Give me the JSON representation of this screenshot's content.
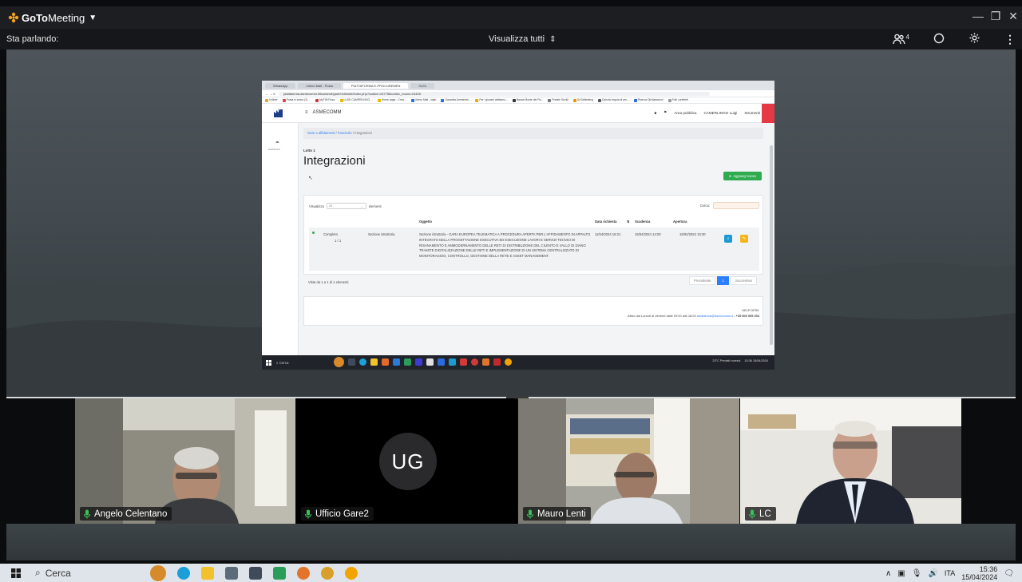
{
  "app": {
    "brand_bold": "GoTo",
    "brand_rest": "Meeting",
    "speaking_label": "Sta parlando:",
    "view_all_label": "Visualizza tutti",
    "participants_count": "4"
  },
  "shared_screen": {
    "tabs": [
      "WhatsApp",
      "Libero Mail - Posta",
      "PIATTAFORMA E-PROCUREMEN",
      "GoTo"
    ],
    "url": "piattaforma.asmecomm.it/backend/gare/richieste/index.php?codice=247758codice_round=24405",
    "bookmarks": [
      "Volture",
      "Posta in arrivo (2) ...",
      "MyTIM Fisso",
      "LUIGI CAMERLINGO ...",
      "Home page - Crea...",
      "Libero Mail - login",
      "Gazzetta Amministr...",
      "Per i giovani abbiamo...",
      "Banca Monte dei Pa...",
      "Portale Sicolli",
      "GoToMeeting",
      "Calcolo regola di am...",
      "Ricerca Dichiarazioni",
      "Tutti i preferiti"
    ],
    "site": {
      "menu_label": "ASMECOMM",
      "header_links": [
        "Area pubblica",
        "CAMERLINGO Luigi",
        "Strumenti"
      ],
      "sidebar_label": "Dashboard",
      "breadcrumb": {
        "link1": "Gare e affidamenti",
        "link2": "Fascicolo",
        "current": "Integrazioni"
      },
      "lotto": "Lotto 1",
      "page_title": "Integrazioni",
      "add_button": "Aggiungi nuovo",
      "show_label": "Visualizza",
      "show_value": "25",
      "show_suffix": "elementi",
      "search_label": "Cerca:",
      "columns": [
        "Oggetto",
        "Data richiesta",
        "Scadenza",
        "Apertura"
      ],
      "row": {
        "status": "Completo",
        "count": "1 / 1",
        "section": "Sezione istruttoria",
        "object": "Sezione istruttoria - GARA EUROPEA TELEMATICA A PROCEDURA APERTA PER L'AFFIDAMENTO IN APPALTO INTEGRATO DELLA PROGETTAZIONE ESECUTIVA ED ESECUZIONE LAVORI E SERVIZI TECNICI DI RISANAMENTO E AMMODERNAMENTO DELLE RETI DI DISTRIBUZIONE DEL CILENTO E VALLO DI DIANO TRAMITE DIGITALIZZAZIONE DELLE RETI E IMPLEMENTAZIONE DI UN SISTEMA CENTRALIZZATO DI MONITORAGGIO, CONTROLLO, GESTIONE DELLA RETE E ASSET MANAGEMENT.",
        "date_request": "11/04/2024 18:21",
        "deadline": "15/04/2024 14:00",
        "opening": "15/04/2024 15:30"
      },
      "footer_info": "Vista da 1 a 1 di 1 elementi",
      "pager": [
        "Precedente",
        "1",
        "Successivo"
      ],
      "help_title": "HELP DESK",
      "help_text": "Attivo dal Lunedì al Venerdì dalle 09:00 alle 18:00",
      "help_email": "assistenza@asmecomm.it",
      "help_phone": "- +39 800 955 054"
    },
    "taskbar": {
      "search": "Cerca",
      "weather": "23°C Previsti rovesci",
      "time": "15:36",
      "date": "15/04/2024"
    }
  },
  "participants": [
    {
      "name": "Angelo Celentano"
    },
    {
      "name": "Ufficio Gare2",
      "initials": "UG"
    },
    {
      "name": "Mauro Lenti"
    },
    {
      "name": "LC"
    }
  ],
  "taskbar": {
    "search_label": "Cerca",
    "lang": "ITA",
    "time": "15:36",
    "date": "15/04/2024"
  }
}
